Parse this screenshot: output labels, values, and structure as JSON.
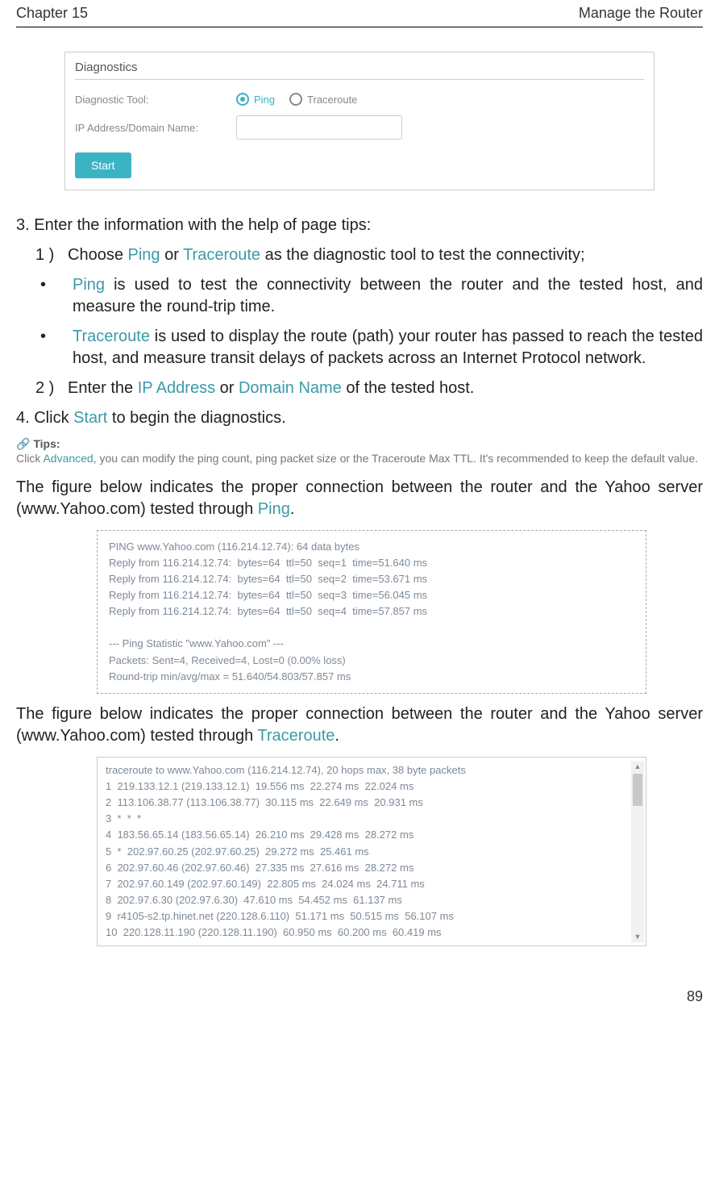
{
  "header": {
    "chapter": "Chapter 15",
    "title": "Manage the Router"
  },
  "diag_panel": {
    "title": "Diagnostics",
    "tool_label": "Diagnostic Tool:",
    "ping": "Ping",
    "traceroute": "Traceroute",
    "ip_label": "IP Address/Domain Name:",
    "start": "Start"
  },
  "steps": {
    "s3": "3. Enter the information with the help of page tips:",
    "s3_1_marker": "1 )",
    "s3_1a": "Choose ",
    "s3_1b": "Ping",
    "s3_1c": " or ",
    "s3_1d": "Traceroute",
    "s3_1e": " as the diagnostic tool to test the connectivity;",
    "bullet1a": "Ping",
    "bullet1b": " is used to test the connectivity between the router and the tested host, and measure the round-trip time.",
    "bullet2a": "Traceroute",
    "bullet2b": " is used to display the route (path) your router has passed to reach the tested host, and measure transit delays of packets across an Internet Protocol network.",
    "s3_2_marker": "2 )",
    "s3_2a": "Enter the ",
    "s3_2b": "IP Address",
    "s3_2c": " or ",
    "s3_2d": "Domain Name",
    "s3_2e": " of the tested host.",
    "s4a": "4. Click ",
    "s4b": "Start",
    "s4c": " to begin the diagnostics."
  },
  "tips": {
    "label": "Tips:",
    "body_a": "Click ",
    "body_b": "Advanced",
    "body_c": ", you can modify the ping count, ping packet size or the Traceroute Max TTL. It's recommended to keep the default value."
  },
  "para_ping_a": "The figure below indicates the proper connection between the router and the Yahoo server (www.Yahoo.com) tested through ",
  "para_ping_b": "Ping",
  "para_ping_c": ".",
  "ping_output": "PING www.Yahoo.com (116.214.12.74): 64 data bytes\nReply from 116.214.12.74:  bytes=64  ttl=50  seq=1  time=51.640 ms\nReply from 116.214.12.74:  bytes=64  ttl=50  seq=2  time=53.671 ms\nReply from 116.214.12.74:  bytes=64  ttl=50  seq=3  time=56.045 ms\nReply from 116.214.12.74:  bytes=64  ttl=50  seq=4  time=57.857 ms\n\n--- Ping Statistic \"www.Yahoo.com\" ---\nPackets: Sent=4, Received=4, Lost=0 (0.00% loss)\nRound-trip min/avg/max = 51.640/54.803/57.857 ms\n",
  "para_trace_a": "The figure below indicates the proper connection between the router and the Yahoo server (www.Yahoo.com) tested through ",
  "para_trace_b": "Traceroute",
  "para_trace_c": ".",
  "trace_output": "traceroute to www.Yahoo.com (116.214.12.74), 20 hops max, 38 byte packets\n1  219.133.12.1 (219.133.12.1)  19.556 ms  22.274 ms  22.024 ms\n2  113.106.38.77 (113.106.38.77)  30.115 ms  22.649 ms  20.931 ms\n3  *  *  *\n4  183.56.65.14 (183.56.65.14)  26.210 ms  29.428 ms  28.272 ms\n5  *  202.97.60.25 (202.97.60.25)  29.272 ms  25.461 ms\n6  202.97.60.46 (202.97.60.46)  27.335 ms  27.616 ms  28.272 ms\n7  202.97.60.149 (202.97.60.149)  22.805 ms  24.024 ms  24.711 ms\n8  202.97.6.30 (202.97.6.30)  47.610 ms  54.452 ms  61.137 ms\n9  r4105-s2.tp.hinet.net (220.128.6.110)  51.171 ms  50.515 ms  56.107 ms\n10  220.128.11.190 (220.128.11.190)  60.950 ms  60.200 ms  60.419 ms",
  "footer": {
    "page": "89"
  }
}
